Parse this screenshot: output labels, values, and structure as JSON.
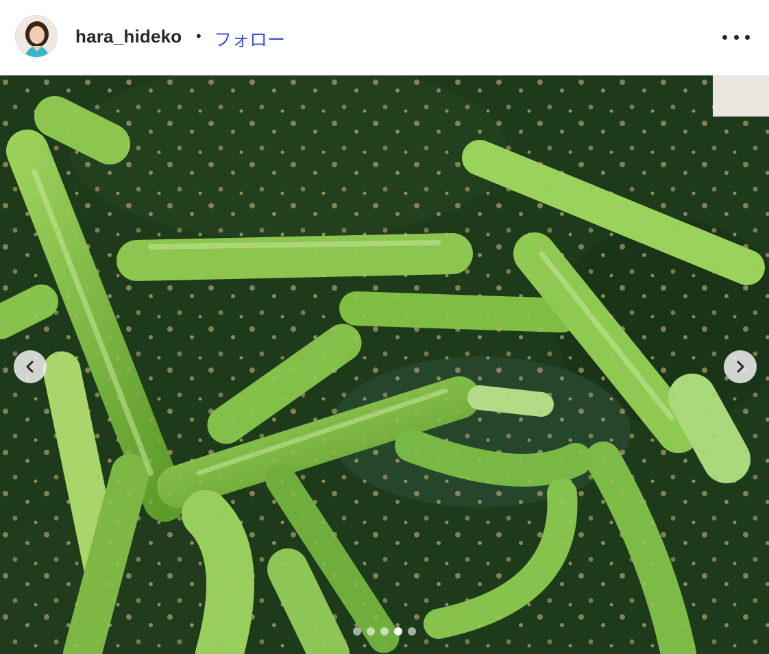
{
  "post": {
    "username": "hara_hideko",
    "separator": "•",
    "follow_label": "フォロー"
  },
  "icons": {
    "more": "more-options-icon",
    "prev": "chevron-left-icon",
    "next": "chevron-right-icon"
  },
  "carousel": {
    "total_slides": 5,
    "active_slide": 4
  },
  "colors": {
    "follow_link": "#3f51d8",
    "text": "#262626"
  }
}
